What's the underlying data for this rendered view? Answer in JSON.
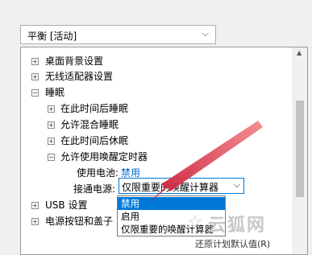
{
  "header_partial_text": "",
  "plan_select": {
    "value": "平衡 [活动]"
  },
  "tree": {
    "items": [
      {
        "label": "桌面背景设置",
        "expander": "+"
      },
      {
        "label": "无线适配器设置",
        "expander": "+"
      },
      {
        "label": "睡眠",
        "expander": "−"
      },
      {
        "label": "在此时间后睡眠",
        "expander": "+"
      },
      {
        "label": "允许混合睡眠",
        "expander": "+"
      },
      {
        "label": "在此时间后休眠",
        "expander": "+"
      },
      {
        "label": "允许使用唤醒定时器",
        "expander": "−"
      },
      {
        "label": "USB 设置",
        "expander": "+"
      },
      {
        "label": "电源按钮和盖子",
        "expander": "+"
      }
    ],
    "battery": {
      "label": "使用电池:",
      "value": "禁用"
    },
    "plugged_in": {
      "label": "接通电源:",
      "value": "仅限重要的唤醒计算器"
    }
  },
  "dropdown_options": [
    "禁用",
    "启用",
    "仅限重要的唤醒计算器"
  ],
  "selected_option_index": 0,
  "bottom_button": {
    "label": "还原计划默认值(R)"
  },
  "watermark": {
    "text": "云狐网"
  },
  "icons": {
    "plan_chevron": "chevron-down-icon",
    "ac_chevron": "chevron-down-icon"
  },
  "colors": {
    "accent": "#0078d7",
    "link": "#0066cc",
    "arrow": "#e0343c"
  }
}
